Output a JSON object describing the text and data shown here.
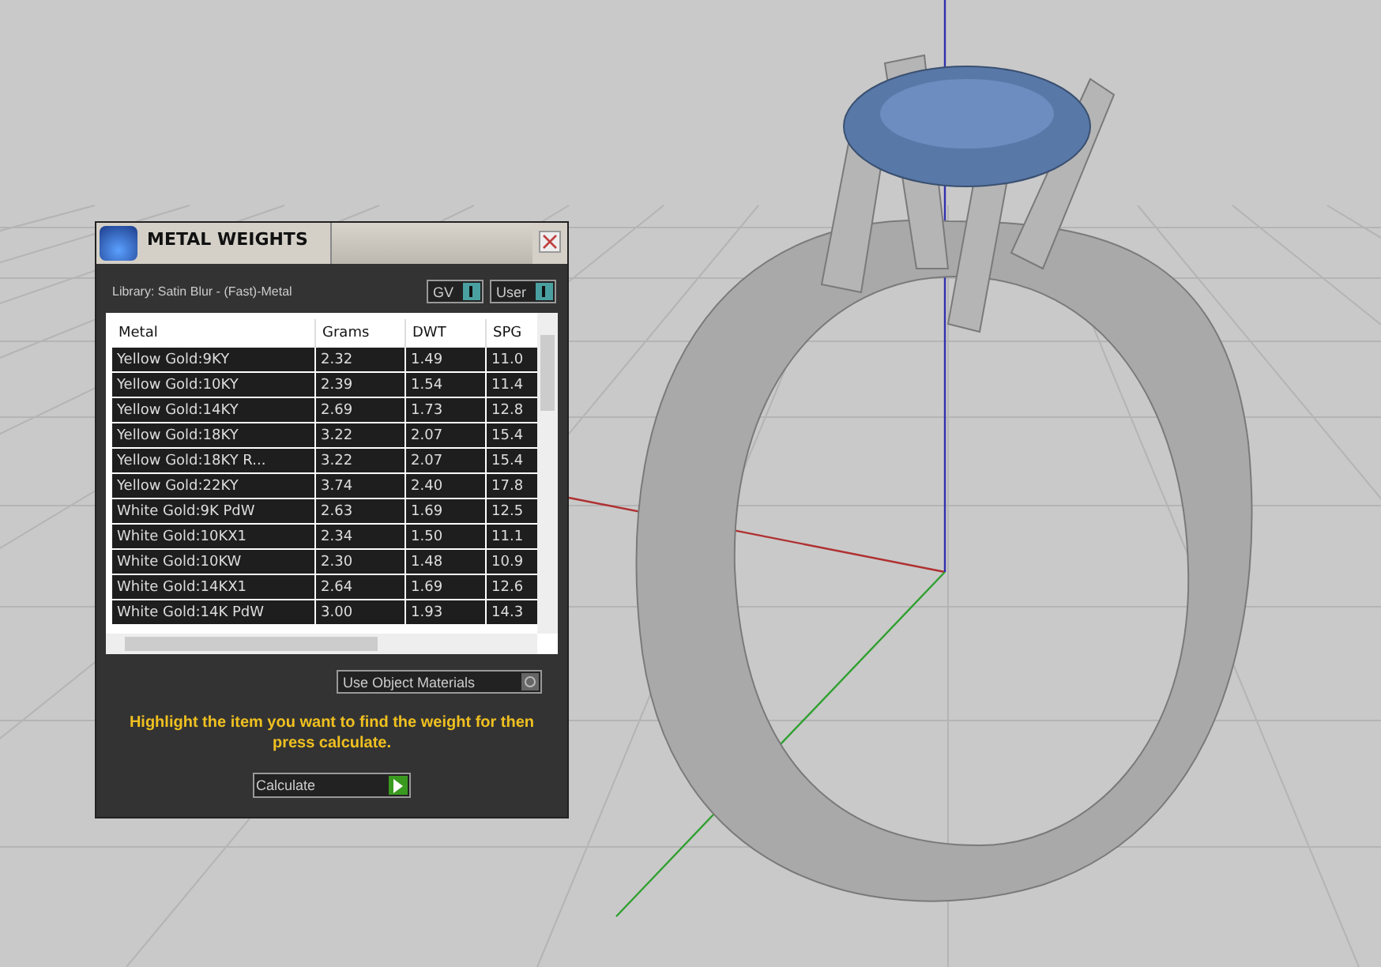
{
  "panel": {
    "title": "METAL WEIGHTS",
    "library": "Library: Satin Blur - (Fast)-Metal",
    "toggles": [
      {
        "label": "GV",
        "on": true
      },
      {
        "label": "User",
        "on": true
      }
    ],
    "table": {
      "columns": [
        "Metal",
        "Grams",
        "DWT",
        "SPG"
      ],
      "rows": [
        [
          "Yellow Gold:9KY",
          "2.32",
          "1.49",
          "11.0"
        ],
        [
          "Yellow Gold:10KY",
          "2.39",
          "1.54",
          "11.4"
        ],
        [
          "Yellow Gold:14KY",
          "2.69",
          "1.73",
          "12.8"
        ],
        [
          "Yellow Gold:18KY",
          "3.22",
          "2.07",
          "15.4"
        ],
        [
          "Yellow Gold:18KY R...",
          "3.22",
          "2.07",
          "15.4"
        ],
        [
          "Yellow Gold:22KY",
          "3.74",
          "2.40",
          "17.8"
        ],
        [
          "White Gold:9K PdW",
          "2.63",
          "1.69",
          "12.5"
        ],
        [
          "White Gold:10KX1",
          "2.34",
          "1.50",
          "11.1"
        ],
        [
          "White Gold:10KW",
          "2.30",
          "1.48",
          "10.9"
        ],
        [
          "White Gold:14KX1",
          "2.64",
          "1.69",
          "12.6"
        ],
        [
          "White Gold:14K PdW",
          "3.00",
          "1.93",
          "14.3"
        ]
      ]
    },
    "use_object_materials": {
      "label": "Use Object Materials",
      "on": false
    },
    "hint": "Highlight the item you want to find the weight for then press calculate.",
    "calculate_button": "Calculate"
  }
}
